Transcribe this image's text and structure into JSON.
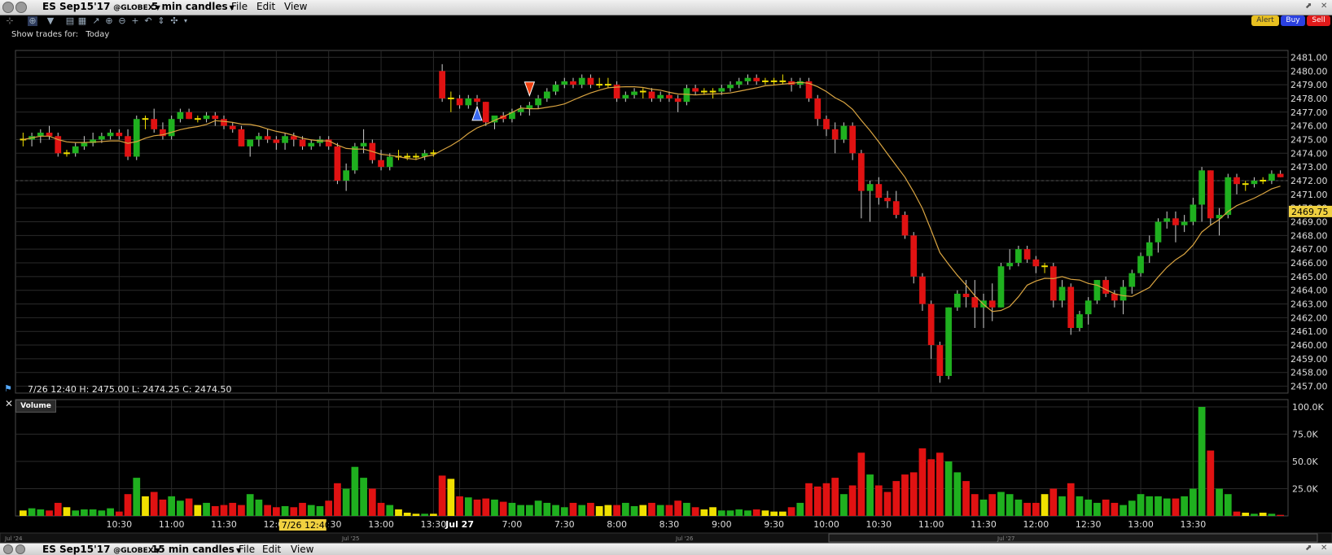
{
  "top_bar": {
    "symbol": "ES Sep15'17",
    "exchange": "@GLOBEX",
    "interval": "5 min candles",
    "menu": [
      "File",
      "Edit",
      "View"
    ]
  },
  "bottom_bar": {
    "symbol": "ES Sep15'17",
    "exchange": "@GLOBEX",
    "interval": "15 min candles",
    "menu": [
      "File",
      "Edit",
      "View"
    ]
  },
  "buttons": {
    "alert": "Alert",
    "buy": "Buy",
    "sell": "Sell"
  },
  "show_trades": {
    "label": "Show trades for:",
    "value": "Today"
  },
  "info_bar": "7/26 12:40    H: 2475.00   L: 2474.25   C: 2474.50",
  "volume_label": "Volume",
  "colors": {
    "up": "#1fb01f",
    "down": "#e01212",
    "doji": "#f0e000",
    "ma": "#d9a441",
    "grid": "#2a2a2a",
    "price_tag": "#f0d040"
  },
  "chart_data": {
    "type": "candlestick",
    "price_axis": [
      "2481.00",
      "2480.00",
      "2479.00",
      "2478.00",
      "2477.00",
      "2476.00",
      "2475.00",
      "2474.00",
      "2473.00",
      "2472.00",
      "2471.00",
      "2470.00",
      "2469.00",
      "2468.00",
      "2467.00",
      "2466.00",
      "2465.00",
      "2464.00",
      "2463.00",
      "2462.00",
      "2461.00",
      "2460.00",
      "2459.00",
      "2458.00",
      "2457.00"
    ],
    "ylim": [
      2456.5,
      2481.5
    ],
    "last_price": "2469.75",
    "volume_axis": [
      "100.0K",
      "75.0K",
      "50.0K",
      "25.0K"
    ],
    "volume_max": 100000,
    "time_labels": [
      "10:30",
      "11:00",
      "11:30",
      "12:00",
      "12:30",
      "13:00",
      "13:30",
      "Jul 27",
      "7:00",
      "7:30",
      "8:00",
      "8:30",
      "9:00",
      "9:30",
      "10:00",
      "10:30",
      "11:00",
      "11:30",
      "12:00",
      "12:30",
      "13:00",
      "13:30"
    ],
    "crosshair_time": "7/26 12:40",
    "overview_labels": [
      "Jul '24",
      "Jul '25",
      "Jul '26",
      "Jul '27"
    ],
    "candles": [
      {
        "o": 2475.0,
        "h": 2475.5,
        "l": 2474.5,
        "c": 2475.0,
        "v": 5000
      },
      {
        "o": 2475.0,
        "h": 2475.5,
        "l": 2474.5,
        "c": 2475.25,
        "v": 7000
      },
      {
        "o": 2475.25,
        "h": 2475.75,
        "l": 2474.75,
        "c": 2475.5,
        "v": 6000
      },
      {
        "o": 2475.5,
        "h": 2476.0,
        "l": 2475.0,
        "c": 2475.25,
        "v": 5000
      },
      {
        "o": 2475.25,
        "h": 2475.5,
        "l": 2473.75,
        "c": 2474.0,
        "v": 12000
      },
      {
        "o": 2474.0,
        "h": 2474.25,
        "l": 2473.75,
        "c": 2474.0,
        "v": 8000
      },
      {
        "o": 2474.0,
        "h": 2474.75,
        "l": 2473.75,
        "c": 2474.5,
        "v": 5000
      },
      {
        "o": 2474.5,
        "h": 2475.25,
        "l": 2474.25,
        "c": 2474.75,
        "v": 6000
      },
      {
        "o": 2474.75,
        "h": 2475.5,
        "l": 2474.5,
        "c": 2475.0,
        "v": 6000
      },
      {
        "o": 2475.0,
        "h": 2475.5,
        "l": 2474.75,
        "c": 2475.25,
        "v": 5000
      },
      {
        "o": 2475.25,
        "h": 2475.75,
        "l": 2475.0,
        "c": 2475.5,
        "v": 7000
      },
      {
        "o": 2475.5,
        "h": 2475.75,
        "l": 2475.0,
        "c": 2475.25,
        "v": 4000
      },
      {
        "o": 2475.25,
        "h": 2475.75,
        "l": 2473.5,
        "c": 2473.75,
        "v": 20000
      },
      {
        "o": 2473.75,
        "h": 2476.75,
        "l": 2473.5,
        "c": 2476.5,
        "v": 35000
      },
      {
        "o": 2476.5,
        "h": 2476.75,
        "l": 2475.75,
        "c": 2476.5,
        "v": 18000
      },
      {
        "o": 2476.5,
        "h": 2477.25,
        "l": 2475.5,
        "c": 2475.75,
        "v": 22000
      },
      {
        "o": 2475.75,
        "h": 2476.25,
        "l": 2475.0,
        "c": 2475.25,
        "v": 15000
      },
      {
        "o": 2475.25,
        "h": 2476.75,
        "l": 2475.0,
        "c": 2476.5,
        "v": 18000
      },
      {
        "o": 2476.5,
        "h": 2477.25,
        "l": 2476.25,
        "c": 2477.0,
        "v": 14000
      },
      {
        "o": 2477.0,
        "h": 2477.25,
        "l": 2476.5,
        "c": 2476.5,
        "v": 16000
      },
      {
        "o": 2476.5,
        "h": 2476.75,
        "l": 2476.25,
        "c": 2476.5,
        "v": 10000
      },
      {
        "o": 2476.5,
        "h": 2477.0,
        "l": 2476.25,
        "c": 2476.75,
        "v": 12000
      },
      {
        "o": 2476.75,
        "h": 2477.0,
        "l": 2476.0,
        "c": 2476.5,
        "v": 9000
      },
      {
        "o": 2476.5,
        "h": 2476.75,
        "l": 2475.75,
        "c": 2476.0,
        "v": 10000
      },
      {
        "o": 2476.0,
        "h": 2476.25,
        "l": 2475.5,
        "c": 2475.75,
        "v": 12000
      },
      {
        "o": 2475.75,
        "h": 2476.0,
        "l": 2474.5,
        "c": 2474.5,
        "v": 10000
      },
      {
        "o": 2474.5,
        "h": 2475.0,
        "l": 2473.75,
        "c": 2475.0,
        "v": 20000
      },
      {
        "o": 2475.0,
        "h": 2475.5,
        "l": 2474.5,
        "c": 2475.25,
        "v": 15000
      },
      {
        "o": 2475.25,
        "h": 2475.75,
        "l": 2474.75,
        "c": 2475.0,
        "v": 10000
      },
      {
        "o": 2475.0,
        "h": 2475.25,
        "l": 2474.25,
        "c": 2474.75,
        "v": 8000
      },
      {
        "o": 2474.75,
        "h": 2475.5,
        "l": 2474.25,
        "c": 2475.25,
        "v": 9000
      },
      {
        "o": 2475.25,
        "h": 2475.5,
        "l": 2474.5,
        "c": 2475.0,
        "v": 8000
      },
      {
        "o": 2475.0,
        "h": 2475.25,
        "l": 2474.25,
        "c": 2474.5,
        "v": 12000
      },
      {
        "o": 2474.5,
        "h": 2475.0,
        "l": 2474.25,
        "c": 2474.75,
        "v": 10000
      },
      {
        "o": 2474.75,
        "h": 2475.25,
        "l": 2474.5,
        "c": 2475.0,
        "v": 9000
      },
      {
        "o": 2475.0,
        "h": 2475.25,
        "l": 2474.25,
        "c": 2474.5,
        "v": 14000
      },
      {
        "o": 2474.5,
        "h": 2474.75,
        "l": 2471.75,
        "c": 2472.0,
        "v": 30000
      },
      {
        "o": 2472.0,
        "h": 2473.25,
        "l": 2471.25,
        "c": 2472.75,
        "v": 25000
      },
      {
        "o": 2472.75,
        "h": 2474.75,
        "l": 2472.5,
        "c": 2474.5,
        "v": 45000
      },
      {
        "o": 2474.5,
        "h": 2475.75,
        "l": 2474.0,
        "c": 2474.75,
        "v": 35000
      },
      {
        "o": 2474.75,
        "h": 2475.0,
        "l": 2473.25,
        "c": 2473.5,
        "v": 25000
      },
      {
        "o": 2473.5,
        "h": 2474.25,
        "l": 2472.75,
        "c": 2473.0,
        "v": 12000
      },
      {
        "o": 2473.0,
        "h": 2474.0,
        "l": 2472.75,
        "c": 2473.75,
        "v": 10000
      },
      {
        "o": 2473.75,
        "h": 2474.25,
        "l": 2473.5,
        "c": 2473.75,
        "v": 6000
      },
      {
        "o": 2473.75,
        "h": 2474.0,
        "l": 2473.5,
        "c": 2473.75,
        "v": 3000
      },
      {
        "o": 2473.75,
        "h": 2474.0,
        "l": 2473.5,
        "c": 2473.75,
        "v": 2000
      },
      {
        "o": 2473.75,
        "h": 2474.25,
        "l": 2473.5,
        "c": 2474.0,
        "v": 2000
      },
      {
        "o": 2474.0,
        "h": 2474.25,
        "l": 2473.75,
        "c": 2474.0,
        "v": 2000
      },
      {
        "o": 2480.0,
        "h": 2480.5,
        "l": 2477.75,
        "c": 2478.0,
        "v": 37000
      },
      {
        "o": 2478.0,
        "h": 2478.5,
        "l": 2477.0,
        "c": 2478.0,
        "v": 34000
      },
      {
        "o": 2478.0,
        "h": 2478.25,
        "l": 2477.25,
        "c": 2477.5,
        "v": 18000
      },
      {
        "o": 2477.5,
        "h": 2478.25,
        "l": 2477.25,
        "c": 2478.0,
        "v": 17000
      },
      {
        "o": 2478.0,
        "h": 2478.25,
        "l": 2477.5,
        "c": 2477.75,
        "v": 15000
      },
      {
        "o": 2477.75,
        "h": 2477.75,
        "l": 2476.0,
        "c": 2476.25,
        "v": 16000
      },
      {
        "o": 2476.25,
        "h": 2476.75,
        "l": 2475.75,
        "c": 2476.75,
        "v": 15000
      },
      {
        "o": 2476.75,
        "h": 2477.0,
        "l": 2476.25,
        "c": 2476.5,
        "v": 13000
      },
      {
        "o": 2476.5,
        "h": 2477.25,
        "l": 2476.25,
        "c": 2477.0,
        "v": 12000
      },
      {
        "o": 2477.0,
        "h": 2477.5,
        "l": 2476.75,
        "c": 2477.25,
        "v": 10000
      },
      {
        "o": 2477.25,
        "h": 2477.75,
        "l": 2476.75,
        "c": 2477.5,
        "v": 10000
      },
      {
        "o": 2477.5,
        "h": 2478.25,
        "l": 2477.25,
        "c": 2478.0,
        "v": 14000
      },
      {
        "o": 2478.0,
        "h": 2478.75,
        "l": 2477.75,
        "c": 2478.5,
        "v": 12000
      },
      {
        "o": 2478.5,
        "h": 2479.25,
        "l": 2478.25,
        "c": 2479.0,
        "v": 10000
      },
      {
        "o": 2479.0,
        "h": 2479.5,
        "l": 2478.75,
        "c": 2479.25,
        "v": 8000
      },
      {
        "o": 2479.25,
        "h": 2479.5,
        "l": 2478.75,
        "c": 2479.0,
        "v": 12000
      },
      {
        "o": 2479.0,
        "h": 2479.75,
        "l": 2478.75,
        "c": 2479.5,
        "v": 10000
      },
      {
        "o": 2479.5,
        "h": 2479.75,
        "l": 2478.75,
        "c": 2479.0,
        "v": 12000
      },
      {
        "o": 2479.0,
        "h": 2479.5,
        "l": 2478.75,
        "c": 2479.0,
        "v": 9000
      },
      {
        "o": 2479.0,
        "h": 2479.5,
        "l": 2478.75,
        "c": 2479.0,
        "v": 10000
      },
      {
        "o": 2479.0,
        "h": 2479.25,
        "l": 2477.75,
        "c": 2478.0,
        "v": 10000
      },
      {
        "o": 2478.0,
        "h": 2478.5,
        "l": 2477.75,
        "c": 2478.25,
        "v": 12000
      },
      {
        "o": 2478.25,
        "h": 2478.75,
        "l": 2478.0,
        "c": 2478.5,
        "v": 9000
      },
      {
        "o": 2478.5,
        "h": 2478.75,
        "l": 2478.0,
        "c": 2478.5,
        "v": 10000
      },
      {
        "o": 2478.5,
        "h": 2478.75,
        "l": 2477.75,
        "c": 2478.0,
        "v": 12000
      },
      {
        "o": 2478.0,
        "h": 2478.5,
        "l": 2477.75,
        "c": 2478.25,
        "v": 10000
      },
      {
        "o": 2478.25,
        "h": 2478.5,
        "l": 2477.75,
        "c": 2478.0,
        "v": 10000
      },
      {
        "o": 2478.0,
        "h": 2478.25,
        "l": 2477.0,
        "c": 2477.75,
        "v": 14000
      },
      {
        "o": 2477.75,
        "h": 2479.0,
        "l": 2477.5,
        "c": 2478.75,
        "v": 12000
      },
      {
        "o": 2478.75,
        "h": 2479.0,
        "l": 2478.25,
        "c": 2478.5,
        "v": 8000
      },
      {
        "o": 2478.5,
        "h": 2478.75,
        "l": 2478.25,
        "c": 2478.5,
        "v": 6000
      },
      {
        "o": 2478.5,
        "h": 2478.75,
        "l": 2478.0,
        "c": 2478.5,
        "v": 8000
      },
      {
        "o": 2478.5,
        "h": 2479.0,
        "l": 2478.25,
        "c": 2478.75,
        "v": 5000
      },
      {
        "o": 2478.75,
        "h": 2479.25,
        "l": 2478.5,
        "c": 2479.0,
        "v": 5000
      },
      {
        "o": 2479.0,
        "h": 2479.5,
        "l": 2478.75,
        "c": 2479.25,
        "v": 6000
      },
      {
        "o": 2479.25,
        "h": 2479.75,
        "l": 2479.0,
        "c": 2479.5,
        "v": 5000
      },
      {
        "o": 2479.5,
        "h": 2479.75,
        "l": 2479.0,
        "c": 2479.25,
        "v": 6000
      },
      {
        "o": 2479.25,
        "h": 2479.5,
        "l": 2479.0,
        "c": 2479.25,
        "v": 5000
      },
      {
        "o": 2479.25,
        "h": 2479.5,
        "l": 2479.0,
        "c": 2479.25,
        "v": 4000
      },
      {
        "o": 2479.25,
        "h": 2479.75,
        "l": 2479.0,
        "c": 2479.25,
        "v": 4000
      },
      {
        "o": 2479.25,
        "h": 2479.5,
        "l": 2478.5,
        "c": 2479.0,
        "v": 8000
      },
      {
        "o": 2479.0,
        "h": 2479.5,
        "l": 2478.75,
        "c": 2479.25,
        "v": 12000
      },
      {
        "o": 2479.25,
        "h": 2479.5,
        "l": 2477.75,
        "c": 2478.0,
        "v": 30000
      },
      {
        "o": 2478.0,
        "h": 2478.25,
        "l": 2476.0,
        "c": 2476.5,
        "v": 27000
      },
      {
        "o": 2476.5,
        "h": 2476.75,
        "l": 2475.25,
        "c": 2475.75,
        "v": 30000
      },
      {
        "o": 2475.75,
        "h": 2476.25,
        "l": 2474.0,
        "c": 2475.0,
        "v": 35000
      },
      {
        "o": 2475.0,
        "h": 2476.25,
        "l": 2474.75,
        "c": 2476.0,
        "v": 20000
      },
      {
        "o": 2476.0,
        "h": 2476.25,
        "l": 2473.5,
        "c": 2474.0,
        "v": 28000
      },
      {
        "o": 2474.0,
        "h": 2474.25,
        "l": 2469.25,
        "c": 2471.25,
        "v": 58000
      },
      {
        "o": 2471.25,
        "h": 2472.0,
        "l": 2469.0,
        "c": 2471.75,
        "v": 38000
      },
      {
        "o": 2471.75,
        "h": 2472.25,
        "l": 2470.25,
        "c": 2470.75,
        "v": 28000
      },
      {
        "o": 2470.75,
        "h": 2471.25,
        "l": 2470.0,
        "c": 2470.5,
        "v": 22000
      },
      {
        "o": 2470.5,
        "h": 2471.25,
        "l": 2469.25,
        "c": 2469.5,
        "v": 32000
      },
      {
        "o": 2469.5,
        "h": 2469.75,
        "l": 2467.75,
        "c": 2468.0,
        "v": 38000
      },
      {
        "o": 2468.0,
        "h": 2468.25,
        "l": 2464.5,
        "c": 2465.0,
        "v": 40000
      },
      {
        "o": 2465.0,
        "h": 2465.25,
        "l": 2462.5,
        "c": 2463.0,
        "v": 62000
      },
      {
        "o": 2463.0,
        "h": 2463.25,
        "l": 2459.0,
        "c": 2460.0,
        "v": 52000
      },
      {
        "o": 2460.0,
        "h": 2460.25,
        "l": 2457.25,
        "c": 2457.75,
        "v": 58000
      },
      {
        "o": 2457.75,
        "h": 2462.75,
        "l": 2457.5,
        "c": 2462.75,
        "v": 50000
      },
      {
        "o": 2462.75,
        "h": 2464.0,
        "l": 2462.5,
        "c": 2463.75,
        "v": 40000
      },
      {
        "o": 2463.75,
        "h": 2464.75,
        "l": 2462.75,
        "c": 2463.5,
        "v": 32000
      },
      {
        "o": 2463.5,
        "h": 2464.75,
        "l": 2461.25,
        "c": 2462.75,
        "v": 20000
      },
      {
        "o": 2462.75,
        "h": 2463.75,
        "l": 2461.25,
        "c": 2463.25,
        "v": 15000
      },
      {
        "o": 2463.25,
        "h": 2464.5,
        "l": 2461.75,
        "c": 2462.75,
        "v": 20000
      },
      {
        "o": 2462.75,
        "h": 2466.0,
        "l": 2462.75,
        "c": 2465.75,
        "v": 22000
      },
      {
        "o": 2465.75,
        "h": 2467.0,
        "l": 2465.5,
        "c": 2466.0,
        "v": 20000
      },
      {
        "o": 2466.0,
        "h": 2467.25,
        "l": 2465.75,
        "c": 2467.0,
        "v": 15000
      },
      {
        "o": 2467.0,
        "h": 2467.25,
        "l": 2466.0,
        "c": 2466.25,
        "v": 12000
      },
      {
        "o": 2466.25,
        "h": 2466.5,
        "l": 2465.25,
        "c": 2465.75,
        "v": 12000
      },
      {
        "o": 2465.75,
        "h": 2466.0,
        "l": 2465.25,
        "c": 2465.75,
        "v": 20000
      },
      {
        "o": 2465.75,
        "h": 2466.0,
        "l": 2462.75,
        "c": 2463.25,
        "v": 25000
      },
      {
        "o": 2463.25,
        "h": 2464.75,
        "l": 2462.75,
        "c": 2464.25,
        "v": 18000
      },
      {
        "o": 2464.25,
        "h": 2464.5,
        "l": 2460.75,
        "c": 2461.25,
        "v": 30000
      },
      {
        "o": 2461.25,
        "h": 2462.5,
        "l": 2461.0,
        "c": 2462.25,
        "v": 18000
      },
      {
        "o": 2462.25,
        "h": 2463.5,
        "l": 2461.5,
        "c": 2463.25,
        "v": 15000
      },
      {
        "o": 2463.25,
        "h": 2464.75,
        "l": 2463.0,
        "c": 2464.75,
        "v": 12000
      },
      {
        "o": 2464.75,
        "h": 2465.0,
        "l": 2463.5,
        "c": 2463.75,
        "v": 15000
      },
      {
        "o": 2463.75,
        "h": 2464.0,
        "l": 2462.75,
        "c": 2463.25,
        "v": 12000
      },
      {
        "o": 2463.25,
        "h": 2464.75,
        "l": 2462.25,
        "c": 2464.25,
        "v": 10000
      },
      {
        "o": 2464.25,
        "h": 2465.5,
        "l": 2463.75,
        "c": 2465.25,
        "v": 14000
      },
      {
        "o": 2465.25,
        "h": 2466.75,
        "l": 2465.0,
        "c": 2466.5,
        "v": 20000
      },
      {
        "o": 2466.5,
        "h": 2468.0,
        "l": 2466.0,
        "c": 2467.5,
        "v": 18000
      },
      {
        "o": 2467.5,
        "h": 2469.25,
        "l": 2466.75,
        "c": 2469.0,
        "v": 18000
      },
      {
        "o": 2469.0,
        "h": 2469.75,
        "l": 2468.5,
        "c": 2469.25,
        "v": 16000
      },
      {
        "o": 2469.25,
        "h": 2469.75,
        "l": 2467.5,
        "c": 2468.75,
        "v": 16000
      },
      {
        "o": 2468.75,
        "h": 2469.5,
        "l": 2468.25,
        "c": 2469.0,
        "v": 18000
      },
      {
        "o": 2469.0,
        "h": 2470.75,
        "l": 2468.75,
        "c": 2470.25,
        "v": 25000
      },
      {
        "o": 2470.25,
        "h": 2473.0,
        "l": 2469.0,
        "c": 2472.75,
        "v": 100000
      },
      {
        "o": 2472.75,
        "h": 2472.75,
        "l": 2468.75,
        "c": 2469.25,
        "v": 60000
      },
      {
        "o": 2469.25,
        "h": 2470.0,
        "l": 2468.0,
        "c": 2469.5,
        "v": 25000
      },
      {
        "o": 2469.5,
        "h": 2472.5,
        "l": 2469.25,
        "c": 2472.25,
        "v": 20000
      },
      {
        "o": 2472.25,
        "h": 2472.5,
        "l": 2471.0,
        "c": 2471.75,
        "v": 4000
      },
      {
        "o": 2471.75,
        "h": 2472.0,
        "l": 2471.25,
        "c": 2471.75,
        "v": 3000
      },
      {
        "o": 2471.75,
        "h": 2472.25,
        "l": 2471.5,
        "c": 2472.0,
        "v": 2000
      },
      {
        "o": 2472.0,
        "h": 2472.25,
        "l": 2471.75,
        "c": 2472.0,
        "v": 3000
      },
      {
        "o": 2472.0,
        "h": 2472.75,
        "l": 2471.75,
        "c": 2472.5,
        "v": 2000
      },
      {
        "o": 2472.5,
        "h": 2472.75,
        "l": 2472.25,
        "c": 2472.25,
        "v": 1000
      }
    ]
  }
}
